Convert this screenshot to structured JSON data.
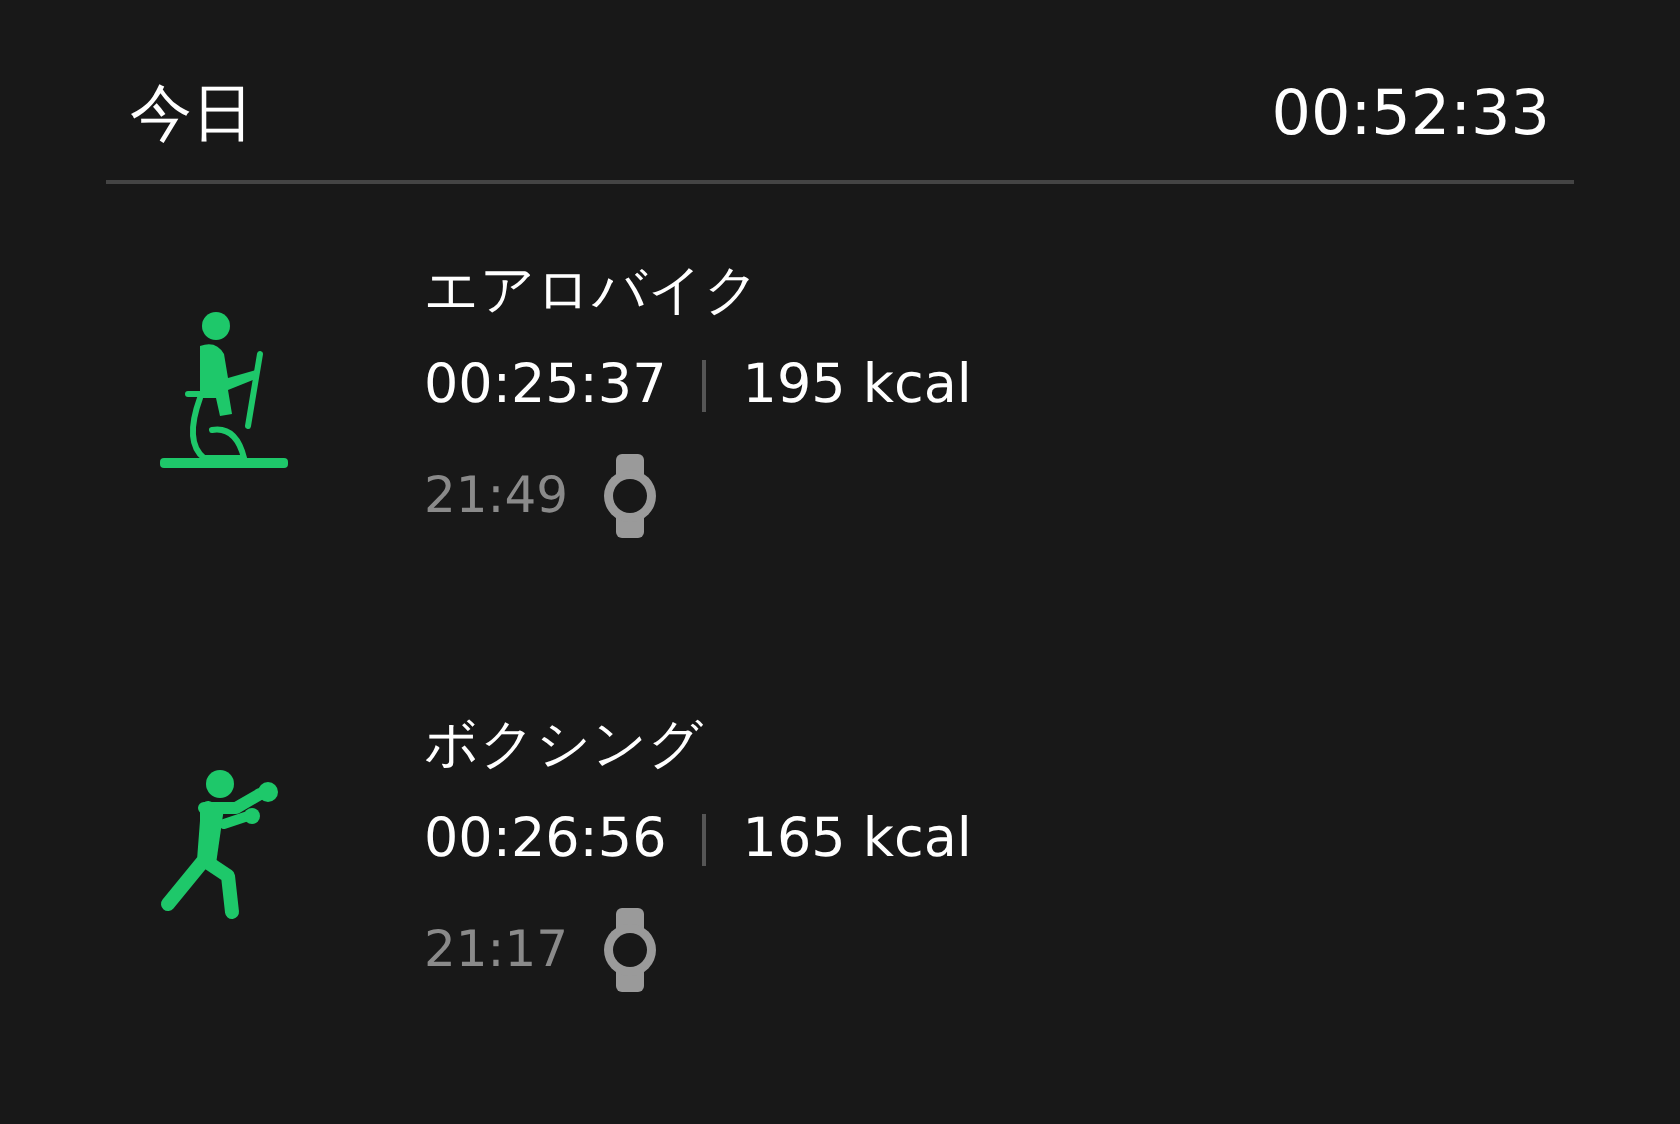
{
  "header": {
    "title": "今日",
    "total": "00:52:33"
  },
  "activities": [
    {
      "kind": "bike",
      "name": "エアロバイク",
      "duration": "00:25:37",
      "calories": "195 kcal",
      "time": "21:49"
    },
    {
      "kind": "boxing",
      "name": "ボクシング",
      "duration": "00:26:56",
      "calories": "165 kcal",
      "time": "21:17"
    }
  ]
}
